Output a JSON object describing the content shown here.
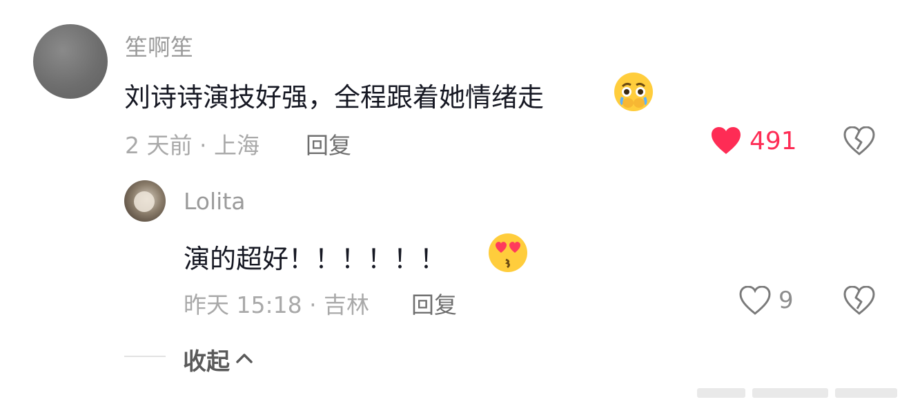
{
  "comment": {
    "username": "笙啊笙",
    "text": "刘诗诗演技好强，全程跟着她情绪走",
    "emoji": "crying-pleading-emoji",
    "meta": "2 天前 · 上海",
    "reply_label": "回复",
    "like_count": "491",
    "liked": true,
    "like_color": "#fe2c55"
  },
  "reply": {
    "username": "Lolita",
    "text": "演的超好！！！！！！",
    "emoji": "kiss-heart-eyes-emoji",
    "meta": "昨天 15:18 · 吉林",
    "reply_label": "回复",
    "like_count": "9",
    "liked": false
  },
  "collapse": {
    "label": "收起"
  }
}
